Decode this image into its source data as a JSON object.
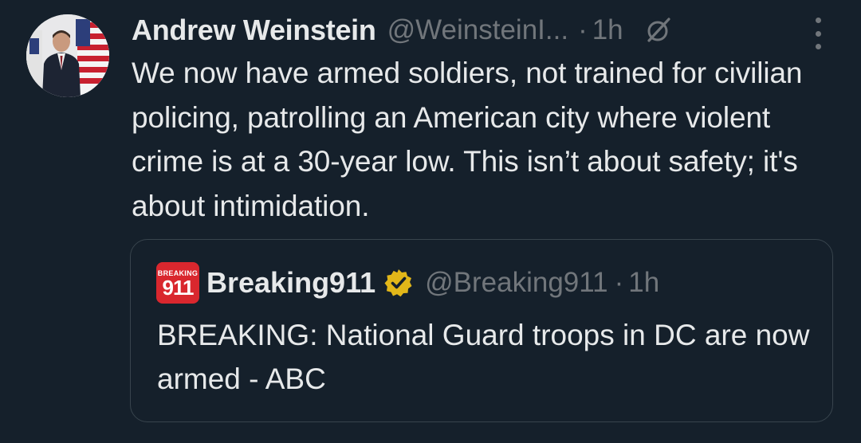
{
  "tweet": {
    "author": {
      "name": "Andrew Weinstein",
      "handle": "@WeinsteinI...",
      "avatar_icon": "profile-photo"
    },
    "separator": "·",
    "time": "1h",
    "grok_icon": "grok-icon",
    "more_icon": "more-vertical-icon",
    "text": "We now have armed soldiers, not trained for civilian policing, patrolling an American city where violent crime is at a 30-year low. This isn’t about safety; it's about intimidation."
  },
  "quoted_tweet": {
    "author": {
      "name": "Breaking911",
      "handle": "@Breaking911",
      "avatar_small_text": "BREAKING",
      "avatar_big_text": "911",
      "verified": true,
      "verified_icon": "gold-verified-badge-icon"
    },
    "separator": "·",
    "time": "1h",
    "text": "BREAKING: National Guard troops in DC are now armed - ABC"
  },
  "colors": {
    "background": "#15202b",
    "primary_text": "#e7e9ea",
    "secondary_text": "#71767b",
    "border": "#38444d",
    "verified_gold": "#e2b719",
    "brand_red": "#d9272e"
  }
}
